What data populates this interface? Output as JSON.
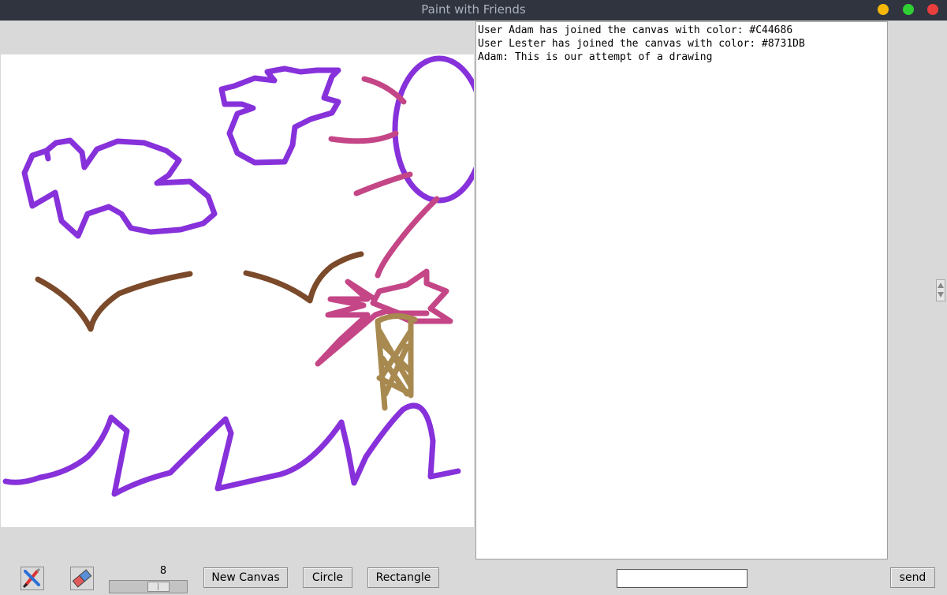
{
  "window": {
    "title": "Paint with Friends"
  },
  "chat": {
    "messages": [
      "User Adam has joined the canvas with color: #C44686",
      "User Lester has joined the canvas with color: #8731DB",
      "Adam: This is our attempt of a drawing"
    ],
    "input_value": "",
    "send_label": "send"
  },
  "toolbar": {
    "brush_icon": "paintbrush-icon",
    "eraser_icon": "eraser-icon",
    "brush_size": "8",
    "brush_size_level": 8,
    "brush_size_max": 30,
    "new_canvas_label": "New Canvas",
    "circle_label": "Circle",
    "rectangle_label": "Rectangle"
  },
  "users": [
    {
      "name": "Adam",
      "color": "#C44686"
    },
    {
      "name": "Lester",
      "color": "#8731DB"
    }
  ],
  "colors": {
    "purple_stroke": "#8731DB",
    "pink_stroke": "#C44686",
    "brown_stroke": "#7B4A2A",
    "tan_stroke": "#A8894F",
    "titlebar": "#2f343f"
  }
}
